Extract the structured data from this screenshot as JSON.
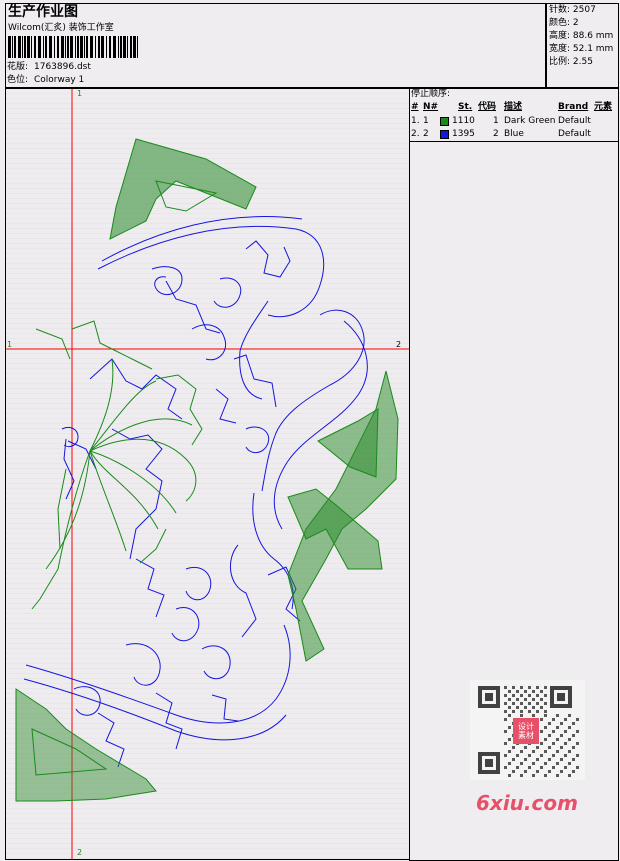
{
  "header": {
    "title": "生产作业图",
    "company": "Wilcom(汇炙)   装饰工作室",
    "design_label": "花版:",
    "design_value": "1763896.dst",
    "colorway_label": "色位:",
    "colorway_value": "Colorway 1"
  },
  "stats": {
    "stitches": "针数: 2507",
    "colors": "颜色: 2",
    "height": "高度: 88.6 mm",
    "width": "宽度: 52.1 mm",
    "ratio": "比例: 2.55"
  },
  "stop_sequence": {
    "title": "停止顺序:",
    "headers": [
      "#",
      "N#",
      "St.",
      "代码",
      "描述",
      "Brand",
      "元素"
    ],
    "rows": [
      {
        "idx": "1.",
        "n": "1",
        "st": "1110",
        "code": "1",
        "desc": "Dark Green",
        "brand": "Default",
        "color": "#1a8a1a"
      },
      {
        "idx": "2.",
        "n": "2",
        "st": "1395",
        "code": "2",
        "desc": "Blue",
        "brand": "Default",
        "color": "#1515e0"
      }
    ]
  },
  "canvas": {
    "axis_top": "1",
    "axis_bottom": "2",
    "axis_left": "1",
    "axis_right": "2"
  },
  "watermark": {
    "text": "6xiu.com",
    "seal": "设计素材"
  },
  "colors": {
    "green": "#1a8a1a",
    "blue": "#1515e0",
    "red_axis": "#ff0000"
  }
}
